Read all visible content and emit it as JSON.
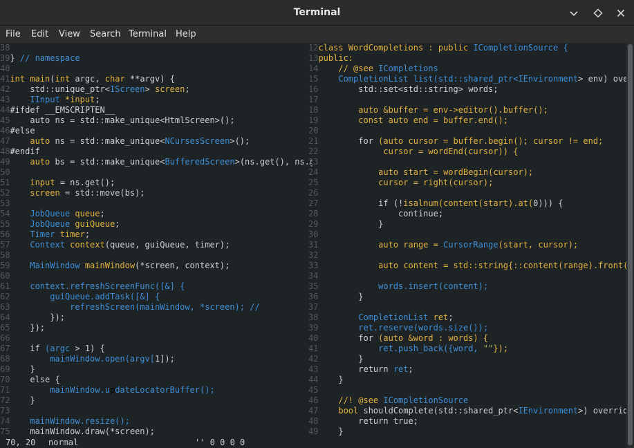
{
  "window": {
    "title": "Terminal"
  },
  "menu": [
    "File",
    "Edit",
    "View",
    "Search",
    "Terminal",
    "Help"
  ],
  "status": {
    "position": "70, 20",
    "mode": "normal",
    "extra": "'' 0 0 0 0"
  },
  "colors": {
    "background": "#1e2326",
    "keyword": "#e3b341",
    "type": "#3f8fd8",
    "text": "#d0d0d0",
    "line_number": "#55595c"
  },
  "left_pane": [
    {
      "n": "38",
      "t": []
    },
    {
      "n": "39",
      "t": [
        [
          "} ",
          "plain"
        ],
        [
          "// namespace",
          "cm"
        ]
      ]
    },
    {
      "n": "40",
      "t": []
    },
    {
      "n": "41",
      "t": [
        [
          "int ",
          "kw"
        ],
        [
          "main",
          "fn"
        ],
        [
          "(",
          "plain"
        ],
        [
          "int ",
          "kw"
        ],
        [
          "argc, ",
          "plain"
        ],
        [
          "char ",
          "kw"
        ],
        [
          "**argv) {",
          "plain"
        ]
      ]
    },
    {
      "n": "42",
      "t": [
        [
          "    std::unique_ptr<",
          "plain"
        ],
        [
          "IScreen",
          "ty"
        ],
        [
          "> ",
          "plain"
        ],
        [
          "screen",
          "fn"
        ],
        [
          ";",
          "plain"
        ]
      ]
    },
    {
      "n": "43",
      "t": [
        [
          "    IInput ",
          "ty"
        ],
        [
          "*input",
          "fn"
        ],
        [
          ";",
          "plain"
        ]
      ]
    },
    {
      "n": "44",
      "t": [
        [
          "#ifdef __EMSCRIPTEN__",
          "pp"
        ]
      ]
    },
    {
      "n": "45",
      "t": [
        [
          "    auto ns = std::make_unique<HtmlScreen>();",
          "plain"
        ]
      ]
    },
    {
      "n": "46",
      "t": [
        [
          "#else",
          "pp"
        ]
      ]
    },
    {
      "n": "47",
      "t": [
        [
          "    auto ",
          "kw"
        ],
        [
          "ns = std::make_unique<",
          "plain"
        ],
        [
          "NCursesScreen",
          "ty"
        ],
        [
          ">();",
          "plain"
        ]
      ]
    },
    {
      "n": "48",
      "t": [
        [
          "#endif",
          "pp"
        ]
      ]
    },
    {
      "n": "49",
      "t": [
        [
          "    auto ",
          "kw"
        ],
        [
          "bs = std::make_unique<",
          "plain"
        ],
        [
          "BufferedScreen",
          "ty"
        ],
        [
          ">(ns.get(), ns.g",
          "plain"
        ]
      ]
    },
    {
      "n": "50",
      "t": []
    },
    {
      "n": "51",
      "t": [
        [
          "    input ",
          "kw"
        ],
        [
          "= ns.get();",
          "plain"
        ]
      ]
    },
    {
      "n": "52",
      "t": [
        [
          "    screen ",
          "kw"
        ],
        [
          "= std::move(bs);",
          "plain"
        ]
      ]
    },
    {
      "n": "53",
      "t": []
    },
    {
      "n": "54",
      "t": [
        [
          "    JobQueue ",
          "ty"
        ],
        [
          "queue",
          "fn"
        ],
        [
          ";",
          "plain"
        ]
      ]
    },
    {
      "n": "55",
      "t": [
        [
          "    JobQueue ",
          "ty"
        ],
        [
          "guiQueue",
          "fn"
        ],
        [
          ";",
          "plain"
        ]
      ]
    },
    {
      "n": "56",
      "t": [
        [
          "    Timer ",
          "ty"
        ],
        [
          "timer",
          "fn"
        ],
        [
          ";",
          "plain"
        ]
      ]
    },
    {
      "n": "57",
      "t": [
        [
          "    Context ",
          "ty"
        ],
        [
          "context",
          "fn"
        ],
        [
          "(queue, guiQueue, timer);",
          "plain"
        ]
      ]
    },
    {
      "n": "58",
      "t": []
    },
    {
      "n": "59",
      "t": [
        [
          "    MainWindow ",
          "ty"
        ],
        [
          "mainWindow",
          "fn"
        ],
        [
          "(*screen, context);",
          "plain"
        ]
      ]
    },
    {
      "n": "60",
      "t": []
    },
    {
      "n": "61",
      "t": [
        [
          "    context.refreshScreenFunc([&] {",
          "ty"
        ]
      ]
    },
    {
      "n": "62",
      "t": [
        [
          "        guiQueue.addTask([&] {",
          "ty"
        ]
      ]
    },
    {
      "n": "63",
      "t": [
        [
          "            refreshScreen(mainWindow, *screen); //",
          "ty"
        ]
      ]
    },
    {
      "n": "64",
      "t": [
        [
          "        });",
          "plain"
        ]
      ]
    },
    {
      "n": "65",
      "t": [
        [
          "    });",
          "plain"
        ]
      ]
    },
    {
      "n": "66",
      "t": []
    },
    {
      "n": "67",
      "t": [
        [
          "    if ",
          "plain"
        ],
        [
          "(argc ",
          "ty"
        ],
        [
          "> ",
          "plain"
        ],
        [
          "1",
          "num"
        ],
        [
          ") {",
          "plain"
        ]
      ]
    },
    {
      "n": "68",
      "t": [
        [
          "        mainWindow.open(argv[",
          "ty"
        ],
        [
          "1",
          "num"
        ],
        [
          "]);",
          "plain"
        ]
      ]
    },
    {
      "n": "69",
      "t": [
        [
          "    }",
          "plain"
        ]
      ]
    },
    {
      "n": "70",
      "t": [
        [
          "    else {",
          "plain"
        ]
      ]
    },
    {
      "n": "71",
      "t": [
        [
          "        mainWindow.u",
          "ty"
        ],
        [
          "p",
          "cursor"
        ],
        [
          "dateLocatorBuffer();",
          "ty"
        ]
      ]
    },
    {
      "n": "72",
      "t": [
        [
          "    }",
          "plain"
        ]
      ]
    },
    {
      "n": "73",
      "t": []
    },
    {
      "n": "74",
      "t": [
        [
          "    mainWindow.resize();",
          "ty"
        ]
      ]
    },
    {
      "n": "75",
      "t": [
        [
          "    mainWindow.draw(*screen);",
          "plain"
        ]
      ]
    }
  ],
  "right_pane": [
    {
      "n": "12",
      "t": [
        [
          "class ",
          "kw"
        ],
        [
          "WordCompletions ",
          "kw"
        ],
        [
          ": public ",
          "kw"
        ],
        [
          "ICompletionSource {",
          "ty"
        ]
      ]
    },
    {
      "n": "13",
      "t": [
        [
          "public:",
          "kw"
        ]
      ]
    },
    {
      "n": "14",
      "t": [
        [
          "    // @see ",
          "kw"
        ],
        [
          "ICompletions",
          "ty"
        ]
      ]
    },
    {
      "n": "15",
      "t": [
        [
          "    CompletionList list",
          "ty"
        ],
        [
          "(std::shared_ptr<",
          "ty"
        ],
        [
          "IEnvironment",
          "ty"
        ],
        [
          "> env) ove",
          "plain"
        ]
      ]
    },
    {
      "n": "16",
      "t": [
        [
          "        std::set<std::string> words;",
          "plain"
        ]
      ]
    },
    {
      "n": "17",
      "t": []
    },
    {
      "n": "18",
      "t": [
        [
          "        auto ",
          "kw"
        ],
        [
          "&buffer = env->editor().buffer();",
          "kw"
        ]
      ]
    },
    {
      "n": "19",
      "t": [
        [
          "        const auto ",
          "kw"
        ],
        [
          "end = buffer.end();",
          "kw"
        ]
      ]
    },
    {
      "n": "20",
      "t": []
    },
    {
      "n": "21",
      "t": [
        [
          "        for ",
          "plain"
        ],
        [
          "(auto ",
          "kw"
        ],
        [
          "cursor = buffer.begin(); cursor != end;",
          "kw"
        ]
      ]
    },
    {
      "n": "22",
      "t": [
        [
          "             cursor = wordEnd(cursor)) {",
          "kw"
        ]
      ]
    },
    {
      "n": "23",
      "t": []
    },
    {
      "n": "24",
      "t": [
        [
          "            auto ",
          "kw"
        ],
        [
          "start = wordBegin(cursor);",
          "kw"
        ]
      ]
    },
    {
      "n": "25",
      "t": [
        [
          "            cursor = right(cursor);",
          "kw"
        ]
      ]
    },
    {
      "n": "26",
      "t": []
    },
    {
      "n": "27",
      "t": [
        [
          "            if ",
          "plain"
        ],
        [
          "(!",
          "plain"
        ],
        [
          "isalnum(content(start).at(",
          "kw"
        ],
        [
          "0",
          "num"
        ],
        [
          "))) {",
          "plain"
        ]
      ]
    },
    {
      "n": "28",
      "t": [
        [
          "                continue;",
          "plain"
        ]
      ]
    },
    {
      "n": "29",
      "t": [
        [
          "            }",
          "plain"
        ]
      ]
    },
    {
      "n": "30",
      "t": []
    },
    {
      "n": "31",
      "t": [
        [
          "            auto ",
          "kw"
        ],
        [
          "range = ",
          "kw"
        ],
        [
          "CursorRange",
          "ty"
        ],
        [
          "(start, cursor);",
          "kw"
        ]
      ]
    },
    {
      "n": "32",
      "t": []
    },
    {
      "n": "33",
      "t": [
        [
          "            auto ",
          "kw"
        ],
        [
          "content = std::string{::content(range).front(",
          "kw"
        ]
      ]
    },
    {
      "n": "34",
      "t": []
    },
    {
      "n": "35",
      "t": [
        [
          "            words.insert(content);",
          "ty"
        ]
      ]
    },
    {
      "n": "36",
      "t": [
        [
          "        }",
          "plain"
        ]
      ]
    },
    {
      "n": "37",
      "t": []
    },
    {
      "n": "38",
      "t": [
        [
          "        CompletionList ",
          "ty"
        ],
        [
          "ret",
          "fn"
        ],
        [
          ";",
          "plain"
        ]
      ]
    },
    {
      "n": "39",
      "t": [
        [
          "        ret.reserve(words.size());",
          "ty"
        ]
      ]
    },
    {
      "n": "40",
      "t": [
        [
          "        for ",
          "plain"
        ],
        [
          "(auto ",
          "kw"
        ],
        [
          "&word : words) {",
          "kw"
        ]
      ]
    },
    {
      "n": "41",
      "t": [
        [
          "            ret.push_back({word, ",
          "ty"
        ],
        [
          "\"\"",
          "str"
        ],
        [
          "});",
          "kw"
        ]
      ]
    },
    {
      "n": "42",
      "t": [
        [
          "        }",
          "plain"
        ]
      ]
    },
    {
      "n": "43",
      "t": [
        [
          "        return ",
          "plain"
        ],
        [
          "ret",
          "ty"
        ],
        [
          ";",
          "plain"
        ]
      ]
    },
    {
      "n": "44",
      "t": [
        [
          "    }",
          "plain"
        ]
      ]
    },
    {
      "n": "45",
      "t": []
    },
    {
      "n": "46",
      "t": [
        [
          "    //! @see ",
          "kw"
        ],
        [
          "ICompletionSource",
          "ty"
        ]
      ]
    },
    {
      "n": "47",
      "t": [
        [
          "    bool ",
          "kw"
        ],
        [
          "shouldComplete(std::shared_ptr<",
          "plain"
        ],
        [
          "IEnvironment",
          "ty"
        ],
        [
          ">) overrid",
          "plain"
        ]
      ]
    },
    {
      "n": "48",
      "t": [
        [
          "        return true;",
          "plain"
        ]
      ]
    },
    {
      "n": "49",
      "t": [
        [
          "    }",
          "plain"
        ]
      ]
    }
  ]
}
